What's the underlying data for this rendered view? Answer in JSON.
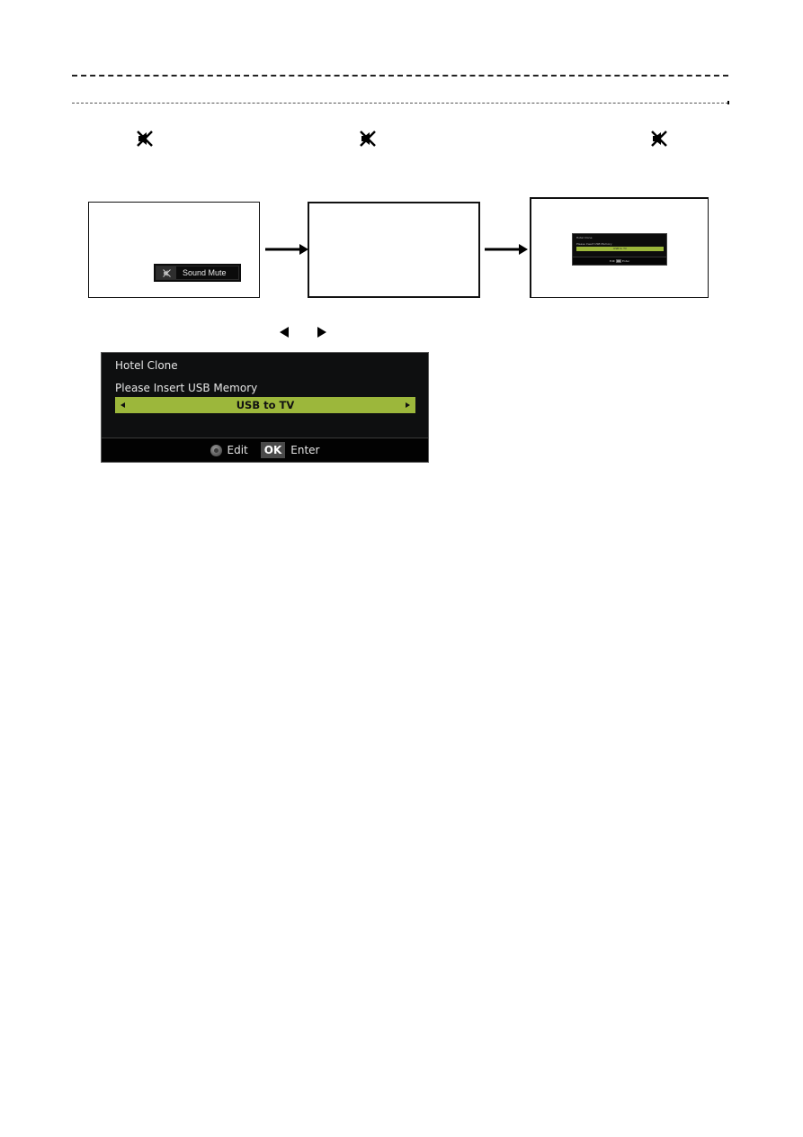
{
  "document": {
    "icons": {
      "mute": "speaker-muted-icon",
      "arrow": "right-arrow-icon",
      "left": "left-triangle-icon",
      "right": "right-triangle-icon",
      "dpad": "dpad-icon"
    }
  },
  "steps": [
    {
      "name": "sound-mute-screen",
      "toast_label": "Sound Mute"
    },
    {
      "name": "blank-screen"
    },
    {
      "name": "hotel-clone-screen",
      "mini_dialog": {
        "title": "Hotel Clone",
        "prompt": "Please Insert USB Memory",
        "option": "USB to TV",
        "edit_label": "Edit",
        "ok_label": "OK",
        "enter_label": "Enter"
      }
    }
  ],
  "dialog": {
    "title": "Hotel Clone",
    "prompt": "Please Insert USB Memory",
    "option_value": "USB to TV",
    "footer": {
      "edit_label": "Edit",
      "ok_key": "OK",
      "enter_label": "Enter"
    },
    "colors": {
      "background": "#0e0f10",
      "highlight": "#9cb73b",
      "footer": "#020202"
    }
  }
}
